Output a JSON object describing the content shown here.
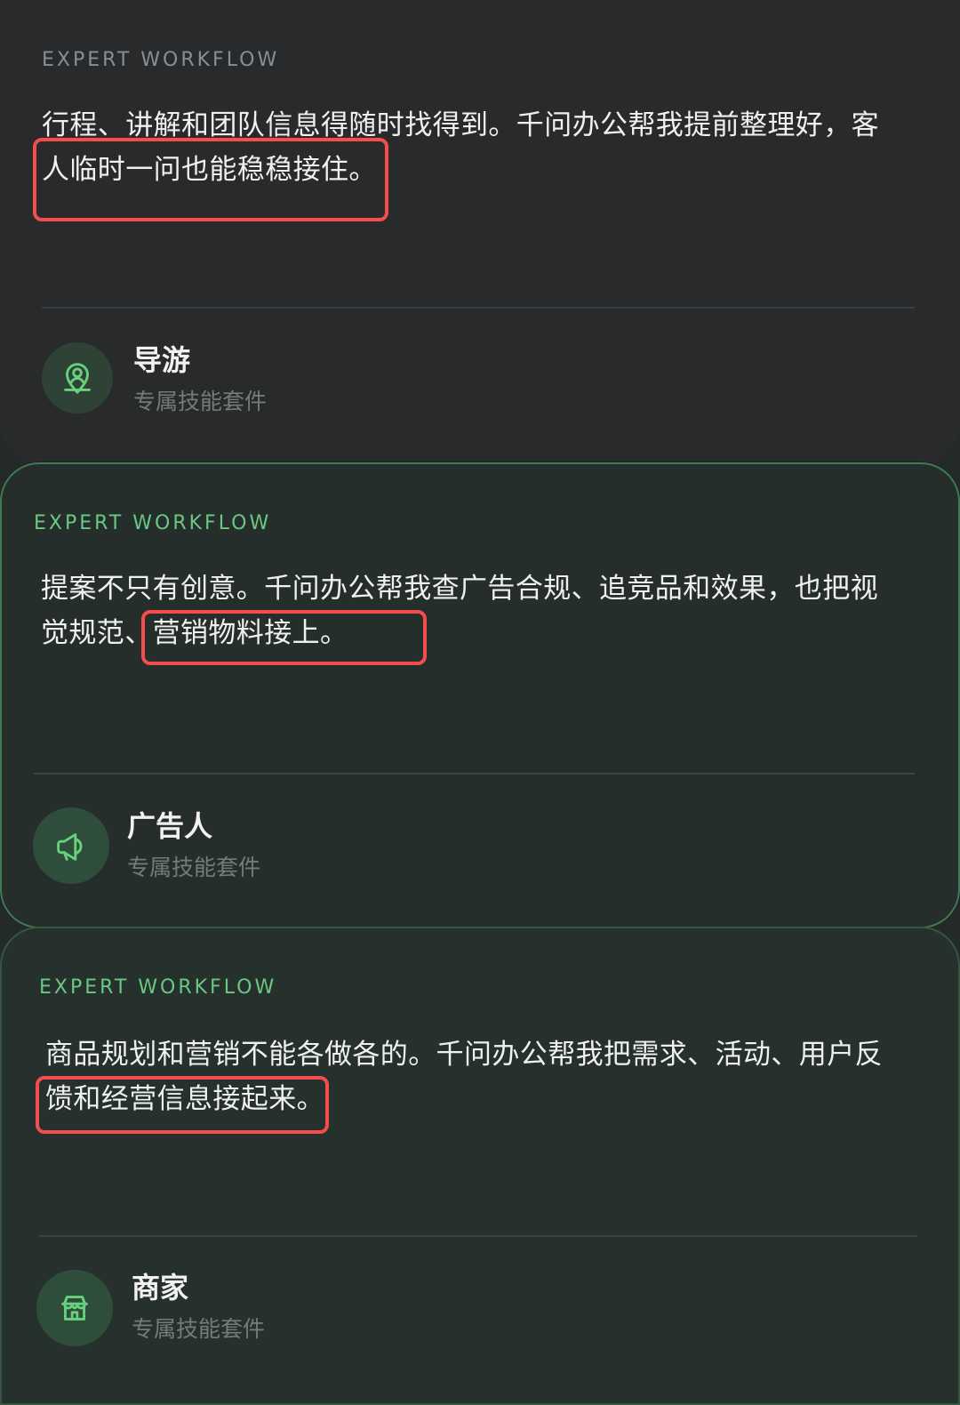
{
  "cards": [
    {
      "eyebrow": "EXPERT WORKFLOW",
      "description": "行程、讲解和团队信息得随时找得到。千问办公帮我提前整理好，客\n人临时一问也能稳稳接住。",
      "title": "导游",
      "subtitle": "专属技能套件",
      "icon": "map-pin-user-icon"
    },
    {
      "eyebrow": "EXPERT WORKFLOW",
      "description": "提案不只有创意。千问办公帮我查广告合规、追竞品和效果，也把视\n觉规范、营销物料接上。",
      "title": "广告人",
      "subtitle": "专属技能套件",
      "icon": "megaphone-icon"
    },
    {
      "eyebrow": "EXPERT WORKFLOW",
      "description": "商品规划和营销不能各做各的。千问办公帮我把需求、活动、用户反\n馈和经营信息接起来。",
      "title": "商家",
      "subtitle": "专属技能套件",
      "icon": "store-icon"
    }
  ],
  "theme": {
    "accent": "#69c882",
    "highlight": "#f44d4b"
  }
}
